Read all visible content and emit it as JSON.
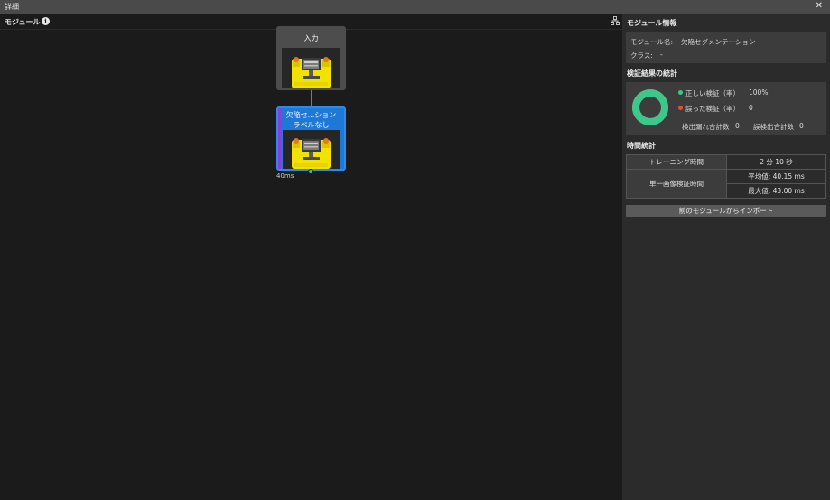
{
  "window": {
    "title": "詳細",
    "close_glyph": "✕"
  },
  "left_panel": {
    "header_label": "モジュール",
    "info_glyph": "i",
    "nodes": {
      "input": {
        "title": "入力"
      },
      "segmentation": {
        "title_line1": "欠陥セ...ション",
        "title_line2": "ラベルなし",
        "time": "40ms"
      }
    }
  },
  "right_panel": {
    "module_info": {
      "title": "モジュール情報",
      "name_label": "モジュール名:",
      "name_value": "欠陥セグメンテーション",
      "class_label": "クラス:",
      "class_value": "-"
    },
    "stats": {
      "title": "検証結果の統計",
      "correct_label": "正しい検証（率）",
      "correct_value": "100%",
      "wrong_label": "誤った検証（率）",
      "wrong_value": "0",
      "missed_label": "検出漏れ合計数",
      "missed_value": "0",
      "false_label": "誤検出合計数",
      "false_value": "0",
      "correct_ratio": 1.0,
      "colors": {
        "correct": "#3cc88a",
        "wrong": "#e0503c"
      }
    },
    "time_stats": {
      "title": "時間統計",
      "training_label": "トレーニング時間",
      "training_value": "2 分 10 秒",
      "single_label": "単一画像検証時間",
      "avg_value": "平均値: 40.15 ms",
      "max_value": "最大値: 43.00 ms"
    },
    "import_button": "前のモジュールからインポート"
  }
}
